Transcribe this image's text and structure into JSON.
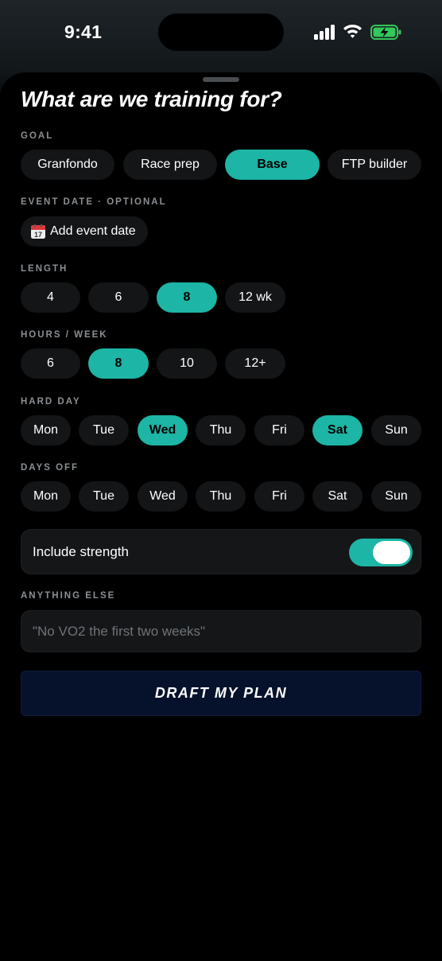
{
  "status_bar": {
    "time": "9:41"
  },
  "sheet": {
    "title": "What are we training for?",
    "goal": {
      "label": "GOAL",
      "options": [
        "Granfondo",
        "Race prep",
        "Base",
        "FTP builder"
      ],
      "selected": "Base"
    },
    "event_date": {
      "label": "EVENT DATE · OPTIONAL",
      "button": "Add event date",
      "icon": "calendar-icon",
      "icon_day": "17"
    },
    "length": {
      "label": "LENGTH",
      "options": [
        "4",
        "6",
        "8",
        "12 wk"
      ],
      "selected": "8"
    },
    "hours_per_week": {
      "label": "HOURS / WEEK",
      "options": [
        "6",
        "8",
        "10",
        "12+"
      ],
      "selected": "8"
    },
    "hard_day": {
      "label": "HARD DAY",
      "options": [
        "Mon",
        "Tue",
        "Wed",
        "Thu",
        "Fri",
        "Sat",
        "Sun"
      ],
      "selected": [
        "Wed",
        "Sat"
      ]
    },
    "days_off": {
      "label": "DAYS OFF",
      "options": [
        "Mon",
        "Tue",
        "Wed",
        "Thu",
        "Fri",
        "Sat",
        "Sun"
      ],
      "selected": []
    },
    "include_strength": {
      "label": "Include strength",
      "enabled": true
    },
    "anything_else": {
      "label": "ANYTHING ELSE",
      "placeholder": "\"No VO2 the first two weeks\"",
      "value": ""
    },
    "draft_button": "DRAFT MY PLAN"
  },
  "colors": {
    "accent": "#1db5a5",
    "pill_bg": "#131517",
    "card_bg": "#141618",
    "button_bg": "#06122b",
    "label_gray": "#8b8f93",
    "battery_green": "#34c759"
  }
}
